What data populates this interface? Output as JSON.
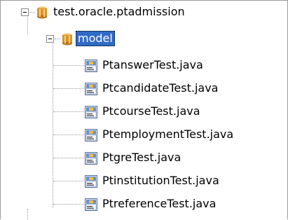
{
  "tree": {
    "root": {
      "label": "test.oracle.ptadmission",
      "icon": "package-icon",
      "expanded": true
    },
    "package": {
      "label": "model",
      "icon": "package-icon",
      "expanded": true,
      "selected": true
    },
    "files": [
      {
        "label": "PtanswerTest.java",
        "icon": "java-class-icon"
      },
      {
        "label": "PtcandidateTest.java",
        "icon": "java-class-icon"
      },
      {
        "label": "PtcourseTest.java",
        "icon": "java-class-icon"
      },
      {
        "label": "PtemploymentTest.java",
        "icon": "java-class-icon"
      },
      {
        "label": "PtgreTest.java",
        "icon": "java-class-icon"
      },
      {
        "label": "PtinstitutionTest.java",
        "icon": "java-class-icon"
      },
      {
        "label": "PtreferenceTest.java",
        "icon": "java-class-icon"
      }
    ]
  },
  "colors": {
    "selection": "#316ac5",
    "package_icon": "#d9952b",
    "class_icon_bg": "#6b8fc8"
  }
}
